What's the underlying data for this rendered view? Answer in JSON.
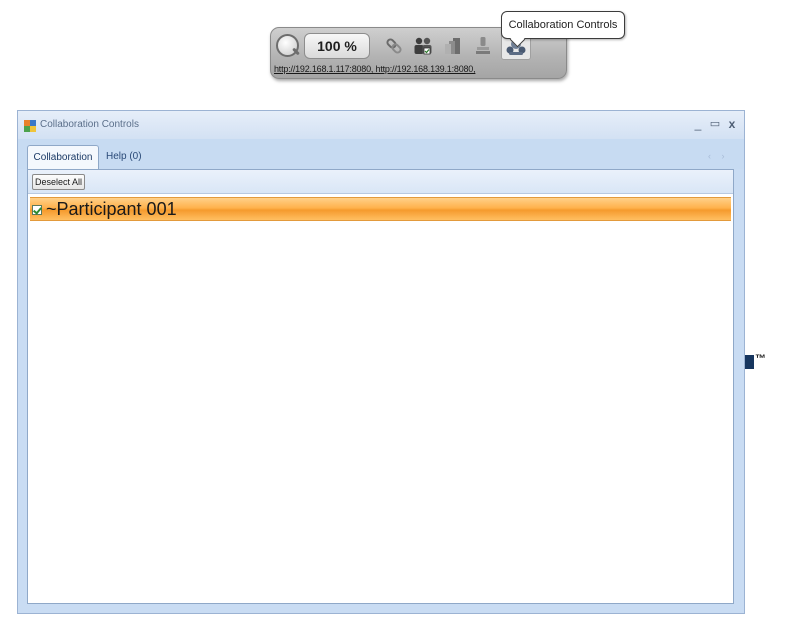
{
  "toolbar": {
    "zoom_level": "100 %",
    "urls": "http://192.168.1.117:8080, http://192.168.139.1:8080,",
    "icons": [
      "zoom-icon",
      "link-icon",
      "users-icon",
      "documents-icon",
      "stamp-icon",
      "collaboration-icon"
    ]
  },
  "tooltip": {
    "text": "Collaboration Controls"
  },
  "window": {
    "title": "Collaboration Controls",
    "controls": {
      "minimize": "_",
      "maximize": "▭",
      "close": "x"
    },
    "tabs": [
      {
        "label": "Collaboration",
        "active": true
      },
      {
        "label": "Help (0)",
        "active": false
      }
    ],
    "tab_scroll": "‹ ›",
    "deselect_all_label": "Deselect All",
    "participants": [
      {
        "name": "~Participant 001",
        "checked": true
      }
    ]
  },
  "trademark": "™",
  "colors": {
    "window_bg": "#c9dcf3",
    "selected_row": "#ffb24c",
    "tm_block": "#17365f"
  }
}
